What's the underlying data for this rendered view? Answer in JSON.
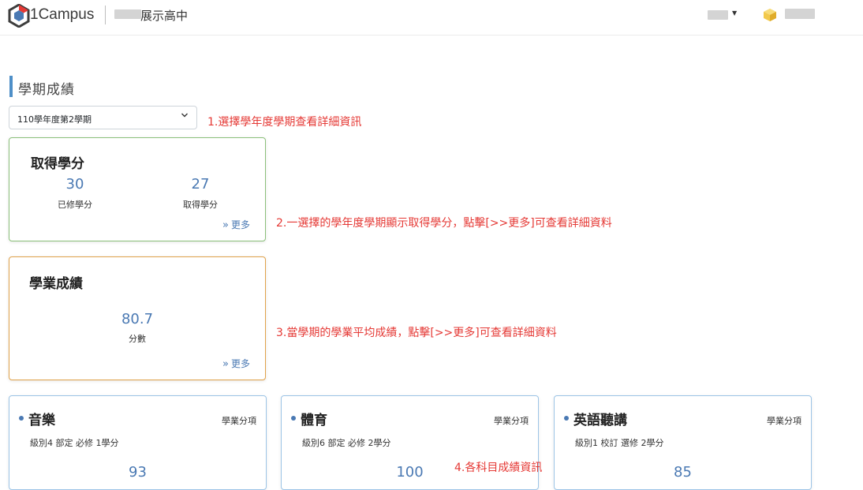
{
  "header": {
    "brand": "1Campus",
    "school_name": "展示高中",
    "user_menu_caret": "▼"
  },
  "page": {
    "section_title": "學期成績",
    "semester_select": {
      "value": "110學年度第2學期"
    }
  },
  "notes": [
    "1.選擇學年度學期查看詳細資訊",
    "2.一選擇的學年度學期顯示取得學分，點擊[>>更多]可查看詳細資料",
    "3.當學期的學業平均成績，點擊[>>更多]可查看詳細資料",
    "4.各科目成績資訊"
  ],
  "credit_card": {
    "title": "取得學分",
    "taken_value": "30",
    "taken_label": "已修學分",
    "earned_value": "27",
    "earned_label": "取得學分",
    "more_arrow": "»",
    "more_label": "更多"
  },
  "grade_card": {
    "title": "學業成績",
    "score_value": "80.7",
    "score_label": "分數",
    "more_arrow": "»",
    "more_label": "更多"
  },
  "subjects": [
    {
      "name": "音樂",
      "category": "學業分項",
      "info": "級別4 部定 必修 1學分",
      "score": "93"
    },
    {
      "name": "體育",
      "category": "學業分項",
      "info": "級別6 部定 必修 2學分",
      "score": "100"
    },
    {
      "name": "英語聽講",
      "category": "學業分項",
      "info": "級別1 校訂 選修 2學分",
      "score": "85"
    }
  ],
  "colors": {
    "accent": "#4a79b3",
    "note_red": "#e53935",
    "credit_border": "#8bc07a",
    "grade_border": "#e0a24a",
    "subject_border": "#9cc4e6"
  }
}
